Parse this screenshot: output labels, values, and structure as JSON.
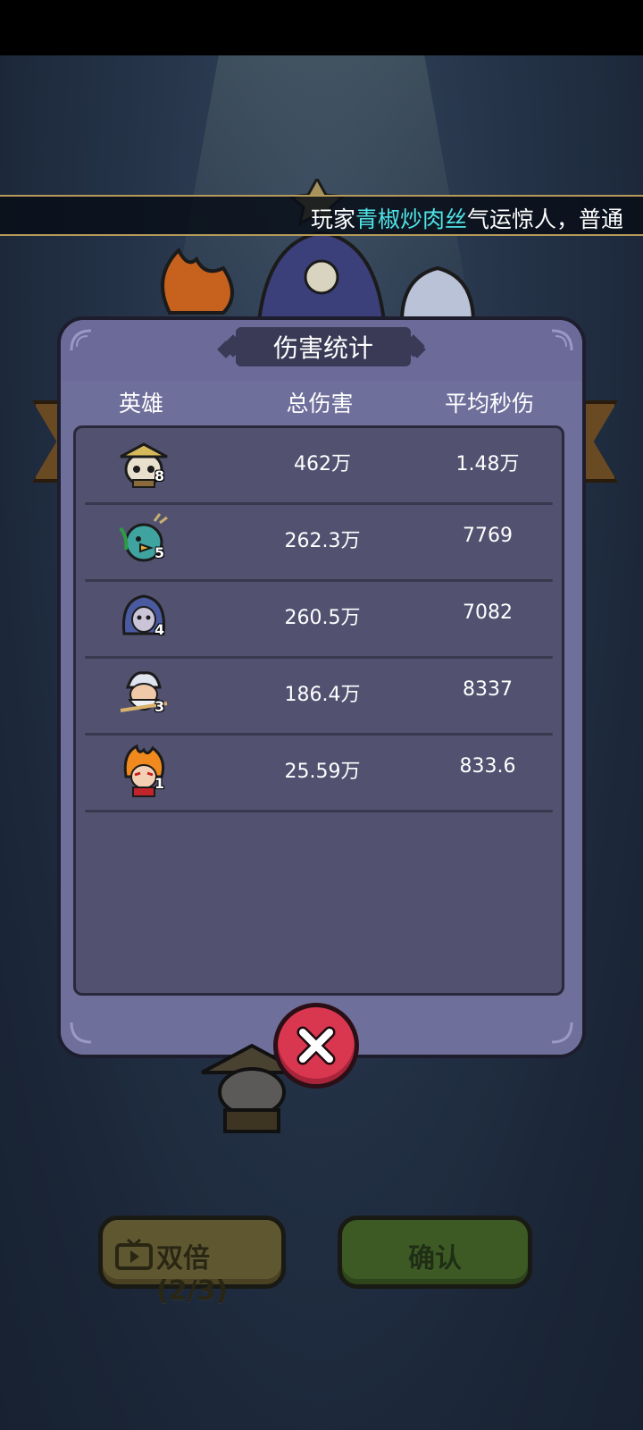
{
  "ticker": {
    "prefix": "玩家",
    "player_name": "青椒炒肉丝",
    "suffix": "气运惊人，普通"
  },
  "dialog": {
    "title": "伤害统计",
    "columns": {
      "hero": "英雄",
      "total_damage": "总伤害",
      "avg_dps": "平均秒伤"
    },
    "rows": [
      {
        "hero_icon": "panda-hero-icon",
        "level": "8",
        "total_damage": "462万",
        "avg_dps": "1.48万"
      },
      {
        "hero_icon": "dragon-bird-hero-icon",
        "level": "5",
        "total_damage": "262.3万",
        "avg_dps": "7769"
      },
      {
        "hero_icon": "blue-hair-hero-icon",
        "level": "4",
        "total_damage": "260.5万",
        "avg_dps": "7082"
      },
      {
        "hero_icon": "white-beard-hero-icon",
        "level": "3",
        "total_damage": "186.4万",
        "avg_dps": "8337"
      },
      {
        "hero_icon": "fire-hero-icon",
        "level": "1",
        "total_damage": "25.59万",
        "avg_dps": "833.6"
      }
    ]
  },
  "buttons": {
    "double_label": "双倍(2/3)",
    "confirm_label": "确认"
  },
  "colors": {
    "player_name": "#4fe3e7",
    "close_button": "#d9374f",
    "dialog_bg": "#6f6f9c",
    "table_bg": "#525170"
  }
}
